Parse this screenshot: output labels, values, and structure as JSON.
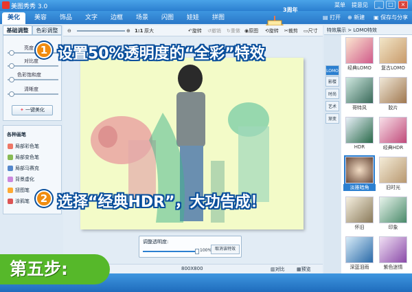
{
  "window": {
    "title": "美图秀秀 3.0",
    "menu": "菜单",
    "feedback": "提意见",
    "minimize": "_",
    "maximize": "□",
    "close": "×"
  },
  "tabs": [
    "美化",
    "美容",
    "饰品",
    "文字",
    "边框",
    "场景",
    "闪图",
    "娃娃",
    "拼图"
  ],
  "actions": {
    "open": "打开",
    "new": "新建",
    "save_share": "保存与分享"
  },
  "anniversary_badge": "3周年",
  "left_tabs": {
    "basic": "基础调整",
    "color": "色彩调整"
  },
  "adjust": {
    "brightness": "亮度",
    "contrast": "对比度",
    "saturation": "色彩饱和度",
    "sharpness": "清晰度",
    "one_key": "一键美化"
  },
  "brushes": {
    "title": "各种画笔",
    "items": [
      "局部彩色笔",
      "局部变色笔",
      "局部马赛克",
      "背景虚化",
      "扭图笔",
      "涂鸦笔"
    ]
  },
  "toolbar": {
    "zoom_ratio": "1:1",
    "original_size": "原大",
    "rotate": "旋转",
    "undo": "撤销",
    "redo": "重做",
    "original": "原图",
    "rotate_img": "旋转",
    "crop": "裁剪",
    "size": "尺寸"
  },
  "opacity_panel": {
    "label": "调整透明度:",
    "value": "100%",
    "cancel": "取消该特效",
    "level": 1.0
  },
  "status": {
    "dimensions": "800X800",
    "compare": "对比",
    "preview": "预览"
  },
  "effects_panel": {
    "header": "特效展示 > LOMO特效",
    "side_tabs": [
      "LOMO",
      "影楼",
      "时尚",
      "艺术",
      "渐变"
    ],
    "items": [
      "经典LOMO",
      "复古LOMO",
      "哥特风",
      "胶片",
      "HDR",
      "经典HDR",
      "淡雅暗角",
      "旧时光",
      "怀旧",
      "印象",
      "深蓝泪雨",
      "紫色迷情"
    ],
    "selected": "淡雅暗角"
  },
  "annotations": {
    "step1_num": "1",
    "step1": "设置50%透明度的“全彩”特效",
    "step2_num": "2",
    "step2": "选择“经典HDR”，大功告成！",
    "step_badge": "第五步:"
  },
  "colors": {
    "brand_blue": "#2b7fd0",
    "accent_orange": "#f08c10",
    "badge_green": "#56b82a",
    "photo_bg": "#f3fbc8"
  }
}
